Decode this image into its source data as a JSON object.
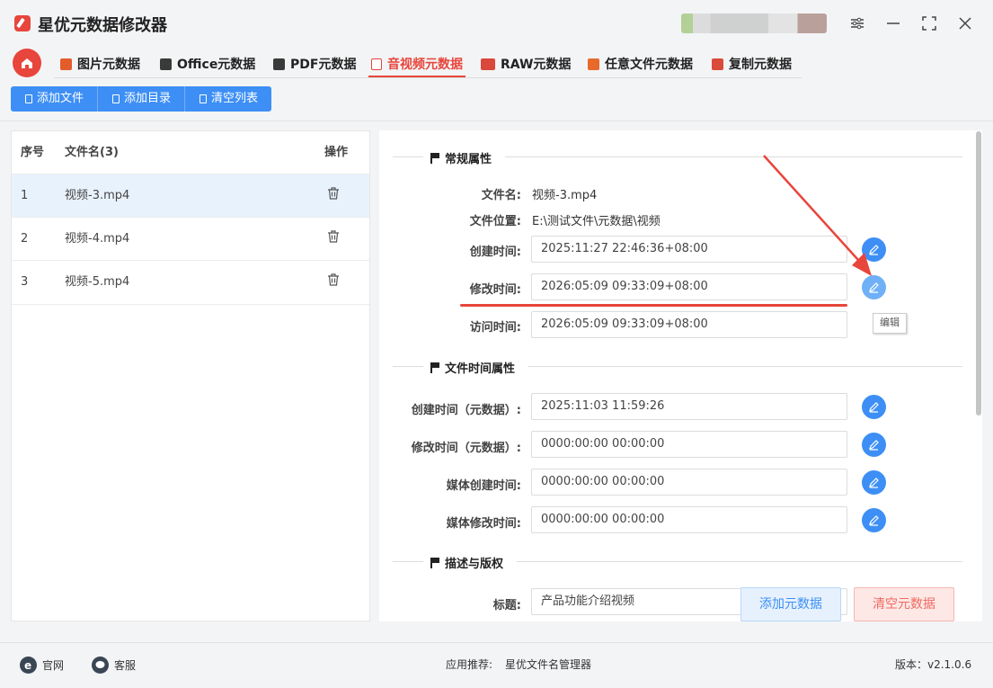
{
  "app": {
    "title": "星优元数据修改器"
  },
  "tabs": [
    {
      "label": "图片元数据",
      "color": "#e35c2b"
    },
    {
      "label": "Office元数据",
      "color": "#3a3a3a"
    },
    {
      "label": "PDF元数据",
      "color": "#3a3a3a"
    },
    {
      "label": "音视频元数据",
      "color": "#e8453c"
    },
    {
      "label": "RAW元数据",
      "color": "#d9483b"
    },
    {
      "label": "任意文件元数据",
      "color": "#e86a2b"
    },
    {
      "label": "复制元数据",
      "color": "#d94b3a"
    }
  ],
  "active_tab": "音视频元数据",
  "toolbar": {
    "add_file": "添加文件",
    "add_dir": "添加目录",
    "clear_list": "清空列表"
  },
  "file_table": {
    "headers": {
      "index": "序号",
      "name": "文件名(3)",
      "action": "操作"
    },
    "rows": [
      {
        "index": "1",
        "name": "视频-3.mp4"
      },
      {
        "index": "2",
        "name": "视频-4.mp4"
      },
      {
        "index": "3",
        "name": "视频-5.mp4"
      }
    ]
  },
  "general": {
    "section_title": "常规属性",
    "file_name_label": "文件名:",
    "file_name": "视频-3.mp4",
    "file_path_label": "文件位置:",
    "file_path": "E:\\测试文件\\元数据\\视频",
    "created_label": "创建时间:",
    "created": "2025:11:27 22:46:36+08:00",
    "modified_label": "修改时间:",
    "modified": "2026:05:09 09:33:09+08:00",
    "accessed_label": "访问时间:",
    "accessed": "2026:05:09 09:33:09+08:00",
    "edit_tooltip": "编辑"
  },
  "file_time": {
    "section_title": "文件时间属性",
    "created_meta_label": "创建时间（元数据）:",
    "created_meta": "2025:11:03 11:59:26",
    "modified_meta_label": "修改时间（元数据）:",
    "modified_meta": "0000:00:00 00:00:00",
    "media_created_label": "媒体创建时间:",
    "media_created": "0000:00:00 00:00:00",
    "media_modified_label": "媒体修改时间:",
    "media_modified": "0000:00:00 00:00:00"
  },
  "desc": {
    "section_title": "描述与版权",
    "title_label": "标题:",
    "title": "产品功能介绍视频"
  },
  "actions": {
    "add_meta": "添加元数据",
    "clear_meta": "清空元数据"
  },
  "footer": {
    "website": "官网",
    "support": "客服",
    "recommend_label": "应用推荐:",
    "recommend_app": "星优文件名管理器",
    "version": "版本：v2.1.0.6"
  }
}
